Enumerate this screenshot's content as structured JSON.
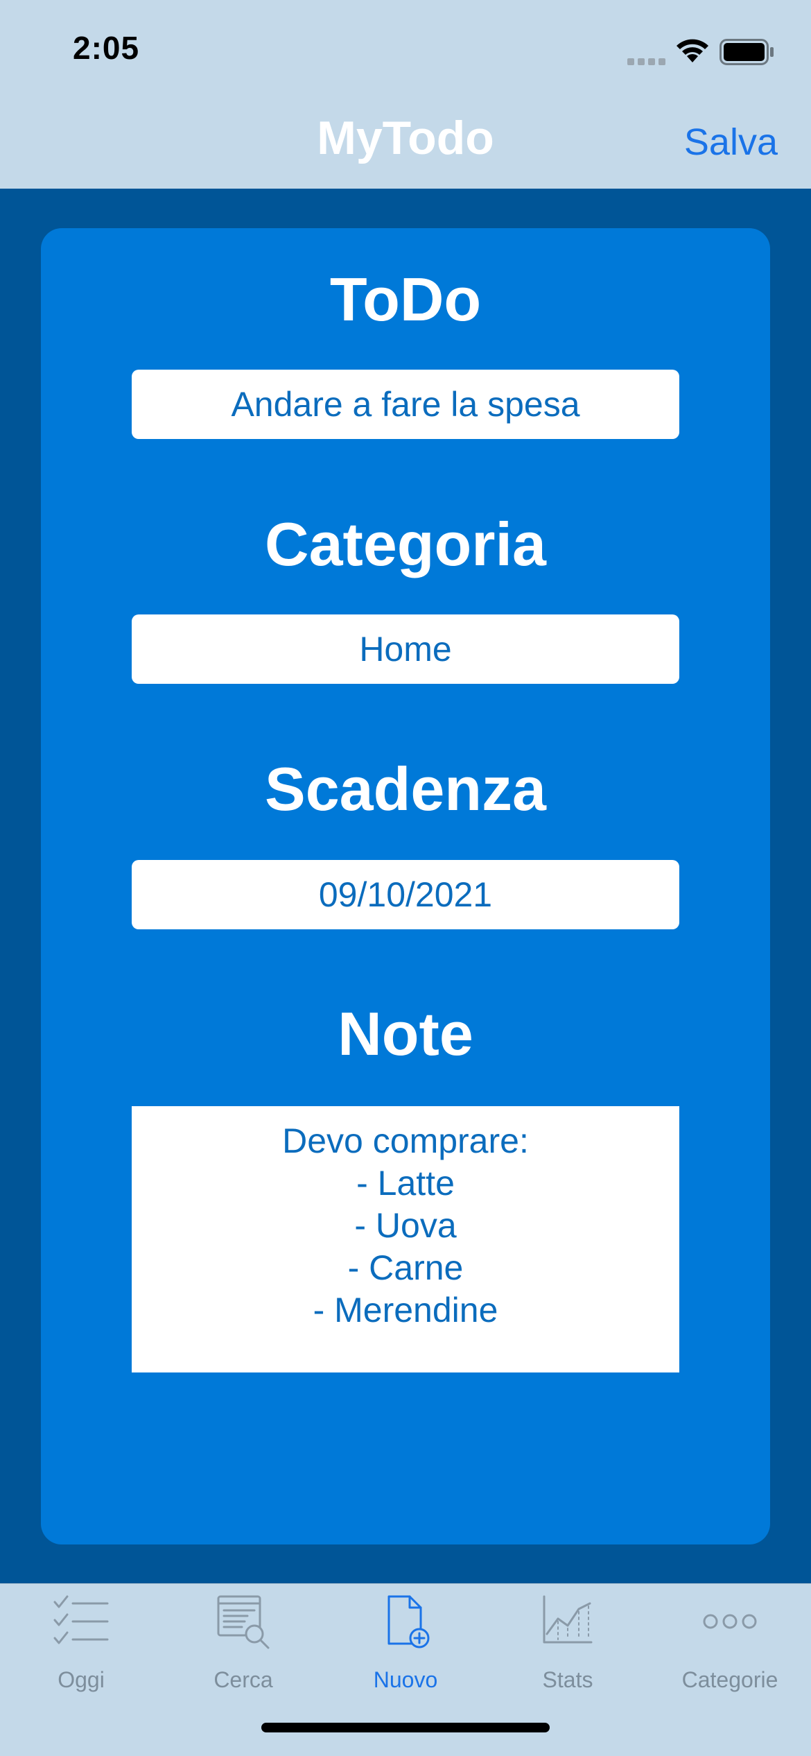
{
  "status_bar": {
    "time": "2:05"
  },
  "nav": {
    "title": "MyTodo",
    "save_label": "Salva"
  },
  "form": {
    "todo": {
      "label": "ToDo",
      "value": "Andare a fare la spesa"
    },
    "category": {
      "label": "Categoria",
      "value": "Home"
    },
    "due_date": {
      "label": "Scadenza",
      "value": "09/10/2021"
    },
    "notes": {
      "label": "Note",
      "lines": [
        "Devo comprare:",
        "- Latte",
        "- Uova",
        "- Carne",
        "- Merendine"
      ]
    }
  },
  "tabs": [
    {
      "label": "Oggi",
      "icon": "checklist-icon",
      "active": false
    },
    {
      "label": "Cerca",
      "icon": "document-search-icon",
      "active": false
    },
    {
      "label": "Nuovo",
      "icon": "document-add-icon",
      "active": true
    },
    {
      "label": "Stats",
      "icon": "chart-icon",
      "active": false
    },
    {
      "label": "Categorie",
      "icon": "more-icon",
      "active": false
    }
  ],
  "colors": {
    "background": "#005597",
    "card": "#0079d8",
    "bars": "#c4d9e9",
    "accent": "#1a73e8",
    "field_text": "#0b6cbd",
    "inactive_tab": "#7d8e9c"
  }
}
